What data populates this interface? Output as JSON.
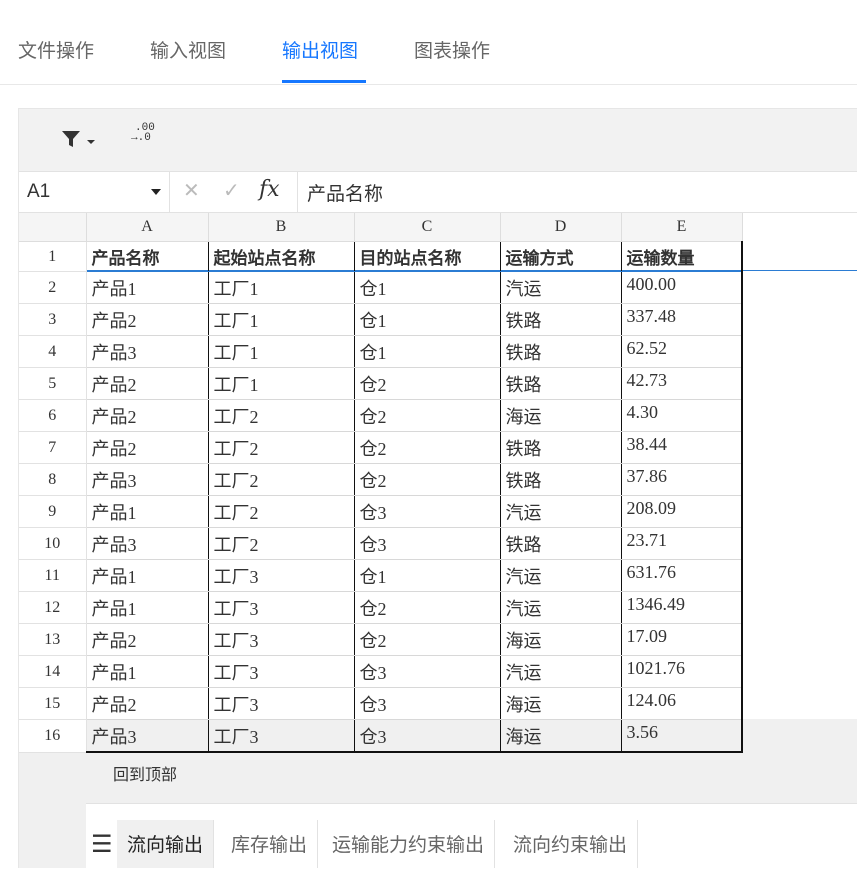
{
  "tabs": [
    "文件操作",
    "输入视图",
    "输出视图",
    "图表操作"
  ],
  "active_tab": "输出视图",
  "accent_color": "#1677ff",
  "toolbar": {
    "filter_icon": "filter-icon",
    "decimal_icon": "decrease-decimal-icon",
    "decimal_top": ".00",
    "decimal_bottom": "→.0"
  },
  "formula_bar": {
    "cell_ref": "A1",
    "fx": "fx",
    "cancel": "✕",
    "confirm": "✓",
    "value": "产品名称"
  },
  "grid": {
    "columns": [
      "A",
      "B",
      "C",
      "D",
      "E"
    ],
    "headers": [
      "产品名称",
      "起始站点名称",
      "目的站点名称",
      "运输方式",
      "运输数量"
    ],
    "row_numbers": [
      "1",
      "2",
      "3",
      "4",
      "5",
      "6",
      "7",
      "8",
      "9",
      "10",
      "11",
      "12",
      "13",
      "14",
      "15",
      "16"
    ],
    "rows": [
      [
        "产品1",
        "工厂1",
        "仓1",
        "汽运",
        "400.00"
      ],
      [
        "产品2",
        "工厂1",
        "仓1",
        "铁路",
        "337.48"
      ],
      [
        "产品3",
        "工厂1",
        "仓1",
        "铁路",
        "62.52"
      ],
      [
        "产品2",
        "工厂1",
        "仓2",
        "铁路",
        "42.73"
      ],
      [
        "产品2",
        "工厂2",
        "仓2",
        "海运",
        "4.30"
      ],
      [
        "产品2",
        "工厂2",
        "仓2",
        "铁路",
        "38.44"
      ],
      [
        "产品3",
        "工厂2",
        "仓2",
        "铁路",
        "37.86"
      ],
      [
        "产品1",
        "工厂2",
        "仓3",
        "汽运",
        "208.09"
      ],
      [
        "产品3",
        "工厂2",
        "仓3",
        "铁路",
        "23.71"
      ],
      [
        "产品1",
        "工厂3",
        "仓1",
        "汽运",
        "631.76"
      ],
      [
        "产品1",
        "工厂3",
        "仓2",
        "汽运",
        "1346.49"
      ],
      [
        "产品2",
        "工厂3",
        "仓2",
        "海运",
        "17.09"
      ],
      [
        "产品1",
        "工厂3",
        "仓3",
        "汽运",
        "1021.76"
      ],
      [
        "产品2",
        "工厂3",
        "仓3",
        "海运",
        "124.06"
      ],
      [
        "产品3",
        "工厂3",
        "仓3",
        "海运",
        "3.56"
      ]
    ]
  },
  "back_to_top": "回到顶部",
  "sheet_tabs": {
    "menu_icon": "☰",
    "items": [
      "流向输出",
      "库存输出",
      "运输能力约束输出",
      "流向约束输出"
    ],
    "active": "流向输出"
  }
}
